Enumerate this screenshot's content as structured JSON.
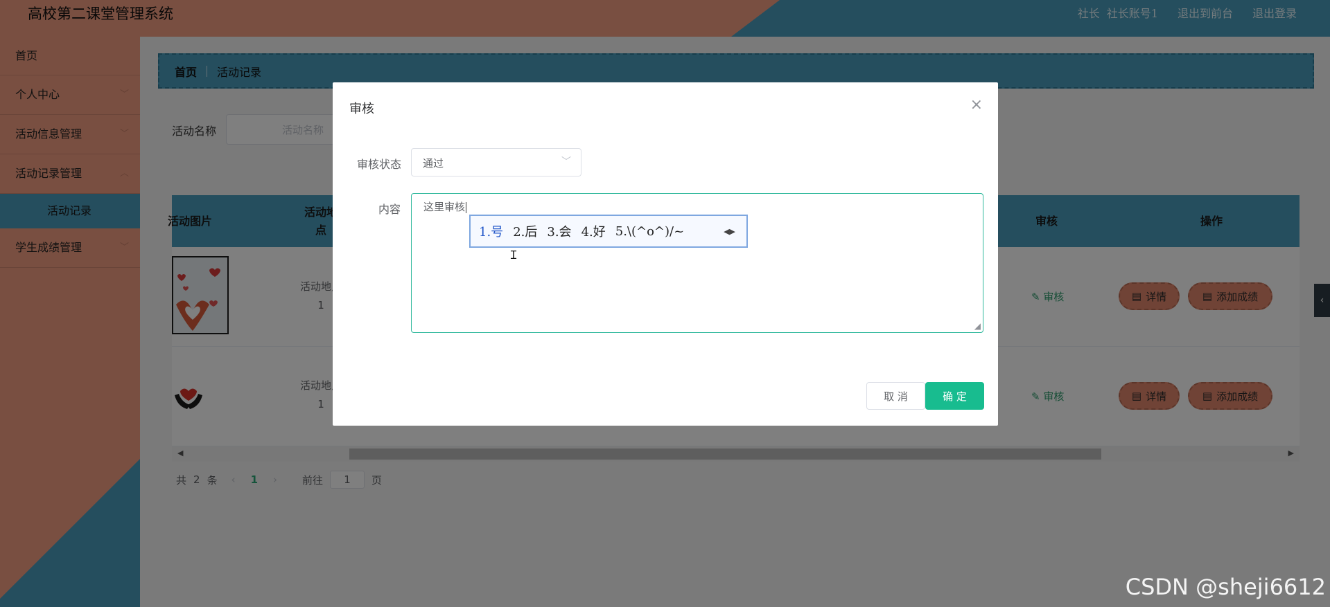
{
  "header": {
    "title": "高校第二课堂管理系统",
    "role": "社长",
    "account": "社长账号1",
    "to_frontend": "退出到前台",
    "logout": "退出登录"
  },
  "sidebar": {
    "items": [
      {
        "label": "首页"
      },
      {
        "label": "个人中心"
      },
      {
        "label": "活动信息管理"
      },
      {
        "label": "活动记录管理"
      },
      {
        "label": "活动记录"
      },
      {
        "label": "学生成绩管理"
      }
    ]
  },
  "breadcrumb": {
    "home": "首页",
    "current": "活动记录"
  },
  "search": {
    "label": "活动名称",
    "placeholder": "活动名称"
  },
  "table": {
    "columns": [
      "活动图片",
      "活动地\n点",
      "审核",
      "操作"
    ],
    "rows": [
      {
        "location_line1": "活动地点",
        "location_line2": "1",
        "audit": "审核",
        "detail": "详情",
        "add_score": "添加成绩"
      },
      {
        "location_line1": "活动地点",
        "location_line2": "1",
        "audit": "审核",
        "detail": "详情",
        "add_score": "添加成绩"
      }
    ]
  },
  "pagination": {
    "total_prefix": "共",
    "total": "2",
    "total_suffix": "条",
    "current_page": "1",
    "goto_label": "前往",
    "goto_value": "1",
    "page_suffix": "页"
  },
  "dialog": {
    "title": "审核",
    "status_label": "审核状态",
    "status_value": "通过",
    "content_label": "内容",
    "content_value": "这里审核",
    "ime_candidates": [
      "1.号",
      "2.后",
      "3.会",
      "4.好",
      "5.\\(^o^)/~"
    ],
    "cancel": "取 消",
    "confirm": "确 定"
  },
  "watermark": "CSDN @sheji6612",
  "colors": {
    "teal": "#4a9cbd",
    "salmon": "#f29f82",
    "primary": "#18bc8f"
  }
}
